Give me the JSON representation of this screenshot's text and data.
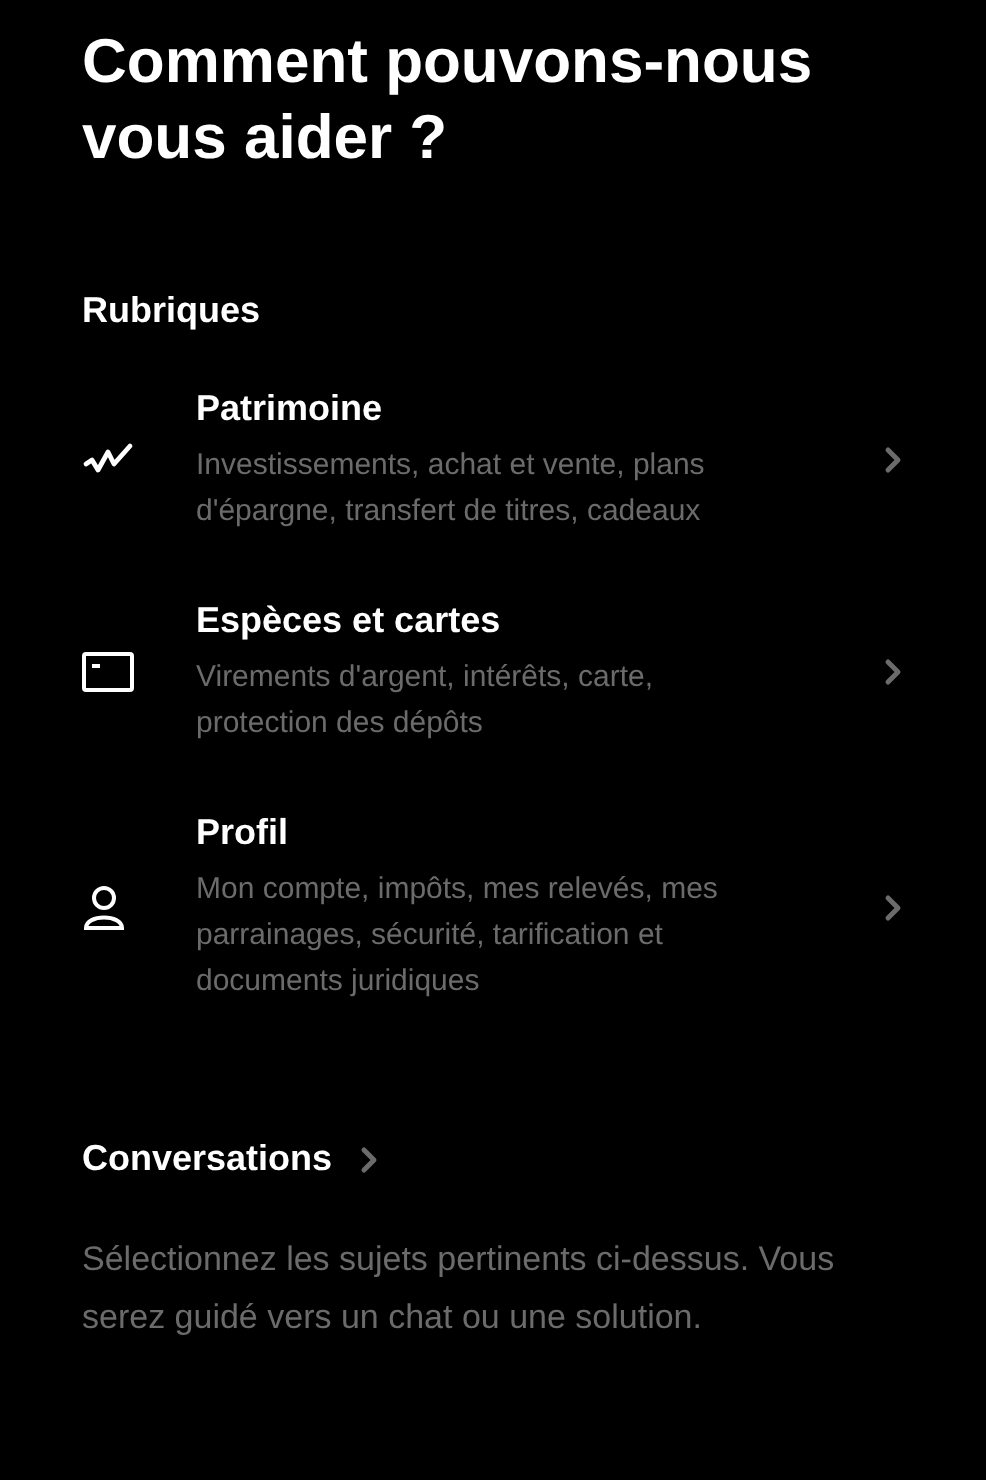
{
  "title": "Comment pouvons-nous vous aider ?",
  "section_title": "Rubriques",
  "topics": [
    {
      "kind": "chart",
      "title": "Patrimoine",
      "description": "Investissements, achat et vente, plans d'épargne, transfert de titres, cadeaux"
    },
    {
      "kind": "card",
      "title": "Espèces et cartes",
      "description": "Virements d'argent, intérêts, carte, protection des dépôts"
    },
    {
      "kind": "person",
      "title": "Profil",
      "description": "Mon compte, impôts, mes relevés, mes parrainages, sécurité, tarification et documents juridiques"
    }
  ],
  "conversations": {
    "label": "Conversations",
    "hint": "Sélectionnez les sujets pertinents ci-dessus. Vous serez guidé vers un chat ou une solution."
  }
}
